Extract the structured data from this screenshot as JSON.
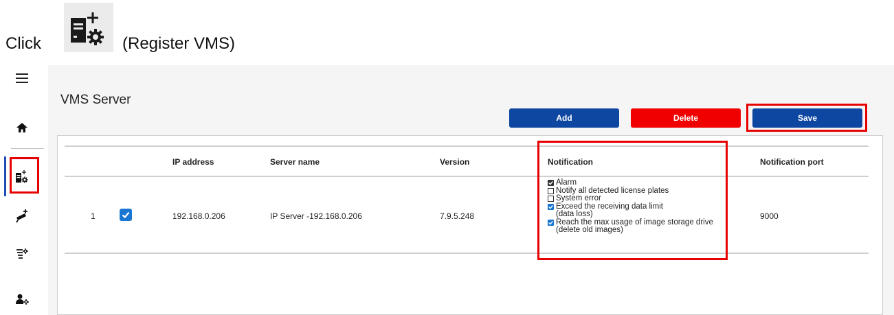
{
  "instruction": {
    "click": "Click",
    "icon": "register-vms-icon",
    "caption": "(Register VMS)"
  },
  "sidebar": {
    "items": [
      {
        "name": "menu",
        "icon": "hamburger-menu-icon"
      },
      {
        "name": "home",
        "icon": "home-icon"
      },
      {
        "name": "register-vms",
        "icon": "register-vms-icon",
        "active": true
      },
      {
        "name": "add-camera",
        "icon": "camera-add-icon"
      },
      {
        "name": "plate-settings",
        "icon": "list-settings-icon"
      },
      {
        "name": "user-settings",
        "icon": "user-settings-icon"
      }
    ]
  },
  "main": {
    "title": "VMS Server",
    "buttons": {
      "add": "Add",
      "delete": "Delete",
      "save": "Save"
    },
    "table": {
      "headers": {
        "ip": "IP address",
        "server": "Server name",
        "version": "Version",
        "notification": "Notification",
        "port": "Notification port"
      },
      "rows": [
        {
          "index": "1",
          "selected": true,
          "ip": "192.168.0.206",
          "server": "IP Server -192.168.0.206",
          "version": "7.9.5.248",
          "notifications": [
            {
              "label": "Alarm",
              "checked": true
            },
            {
              "label": "Notify all detected license plates",
              "checked": false
            },
            {
              "label": "System error",
              "checked": false
            },
            {
              "label": "Exceed the receiving data limit",
              "sub": "(data loss)",
              "checked": true
            },
            {
              "label": "Reach the max usage of image storage drive",
              "sub": "(delete old images)",
              "checked": true
            }
          ],
          "port": "9000"
        }
      ]
    }
  },
  "colors": {
    "primary": "#0d47a1",
    "danger": "#f00000",
    "highlight": "#e60000",
    "checkbox": "#1976d2"
  }
}
